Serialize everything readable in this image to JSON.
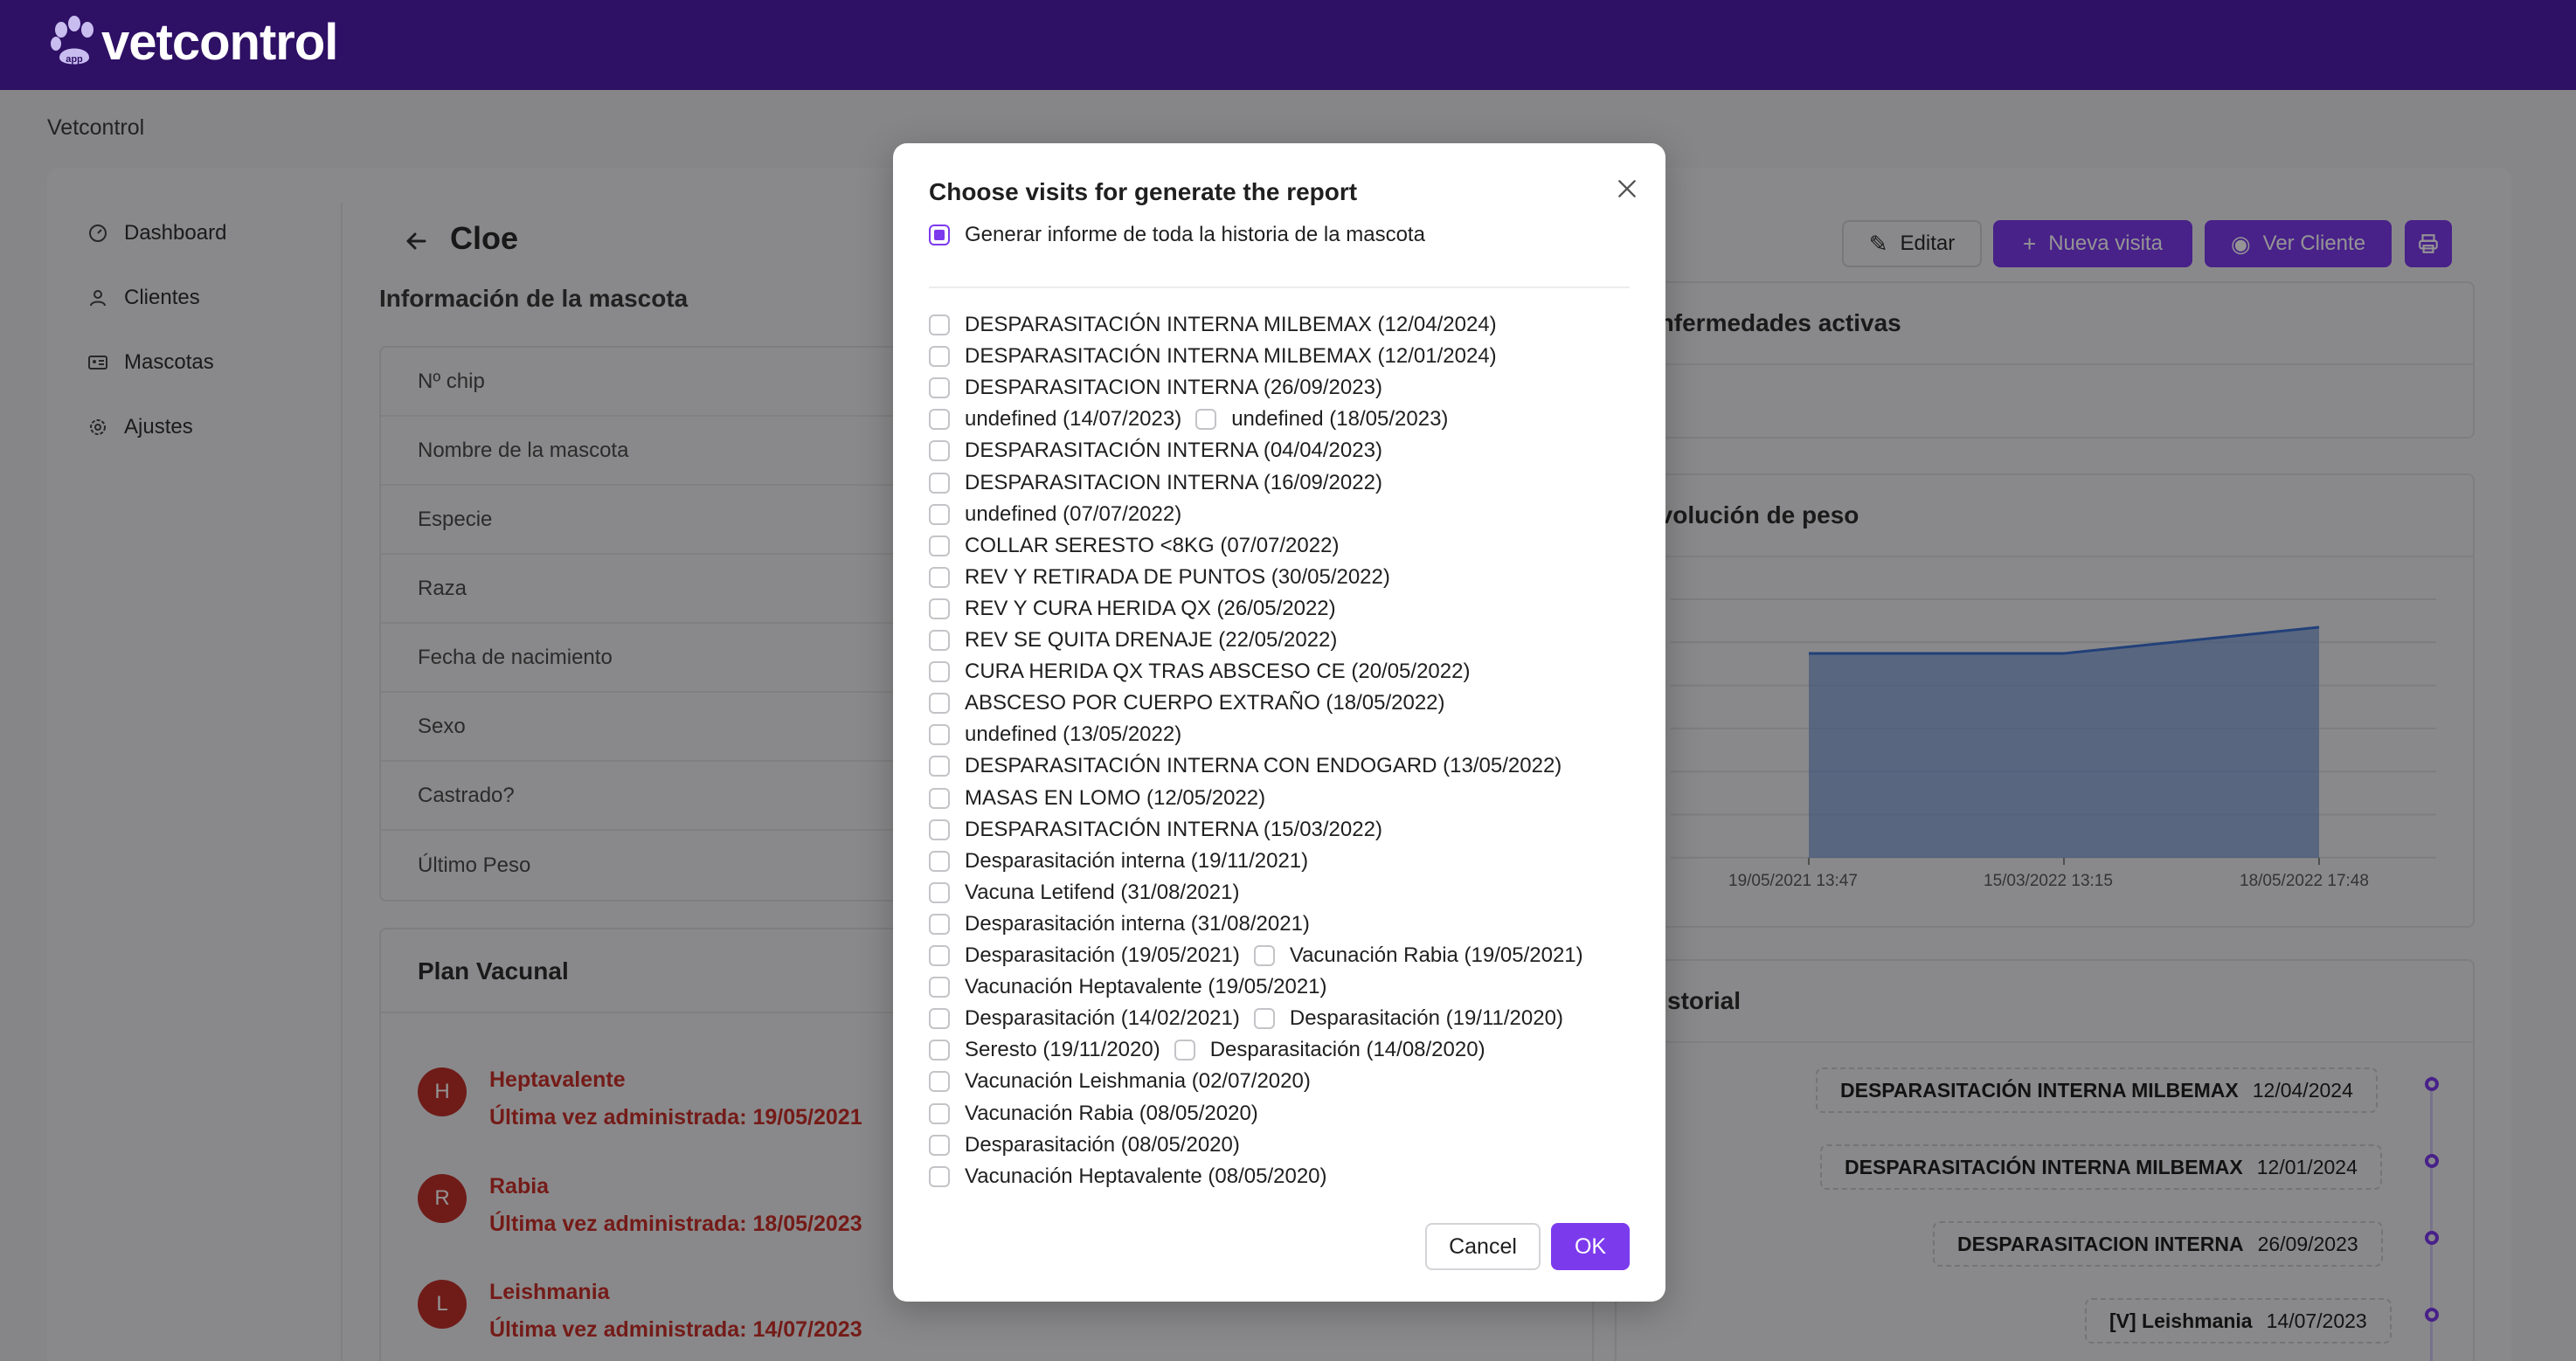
{
  "app": {
    "name": "vetcontrol",
    "badge": "app"
  },
  "breadcrumb": "Vetcontrol",
  "sidebar": {
    "items": [
      {
        "label": "Dashboard",
        "icon": "dashboard-icon"
      },
      {
        "label": "Clientes",
        "icon": "user-icon"
      },
      {
        "label": "Mascotas",
        "icon": "id-card-icon"
      },
      {
        "label": "Ajustes",
        "icon": "gear-icon"
      }
    ]
  },
  "pet": {
    "name": "Cloe",
    "info_title": "Información de la mascota",
    "fields": [
      "Nº chip",
      "Nombre de la mascota",
      "Especie",
      "Raza",
      "Fecha de nacimiento",
      "Sexo",
      "Castrado?",
      "Último Peso"
    ]
  },
  "vaccines": {
    "title": "Plan Vacunal",
    "items": [
      {
        "initial": "H",
        "name": "Heptavalente",
        "last": "Última vez administrada: 19/05/2021"
      },
      {
        "initial": "R",
        "name": "Rabia",
        "last": "Última vez administrada: 18/05/2023"
      },
      {
        "initial": "L",
        "name": "Leishmania",
        "last": "Última vez administrada: 14/07/2023"
      }
    ]
  },
  "toolbar": {
    "edit": "Editar",
    "new_visit": "Nueva visita",
    "view_client": "Ver Cliente"
  },
  "right": {
    "diseases_title": "Enfermedades activas",
    "weight_title": "Evolución de peso",
    "history_title": "Historial",
    "history": [
      {
        "title": "DESPARASITACIÓN INTERNA MILBEMAX",
        "date": "12/04/2024"
      },
      {
        "title": "DESPARASITACIÓN INTERNA MILBEMAX",
        "date": "12/01/2024"
      },
      {
        "title": "DESPARASITACION INTERNA",
        "date": "26/09/2023"
      },
      {
        "title": "[V] Leishmania",
        "date": "14/07/2023"
      }
    ]
  },
  "chart_data": {
    "type": "area",
    "x": [
      "19/05/2021 13:47",
      "15/03/2022 13:15",
      "18/05/2022 17:48"
    ],
    "values": [
      null,
      null,
      null
    ],
    "shape": [
      0.78,
      0.78,
      0.88
    ],
    "grid": true,
    "color": "#7b9bd6"
  },
  "modal": {
    "title": "Choose visits for generate the report",
    "all_history": "Generar informe de toda la historia de la mascota",
    "rows": [
      [
        "DESPARASITACIÓN INTERNA MILBEMAX (12/04/2024)"
      ],
      [
        "DESPARASITACIÓN INTERNA MILBEMAX (12/01/2024)"
      ],
      [
        "DESPARASITACION INTERNA (26/09/2023)"
      ],
      [
        "undefined (14/07/2023)",
        "undefined (18/05/2023)"
      ],
      [
        "DESPARASITACIÓN INTERNA (04/04/2023)"
      ],
      [
        "DESPARASITACION INTERNA (16/09/2022)"
      ],
      [
        "undefined (07/07/2022)"
      ],
      [
        "COLLAR SERESTO <8KG (07/07/2022)"
      ],
      [
        "REV Y RETIRADA DE PUNTOS (30/05/2022)"
      ],
      [
        "REV Y CURA HERIDA QX (26/05/2022)"
      ],
      [
        "REV SE QUITA DRENAJE (22/05/2022)"
      ],
      [
        "CURA HERIDA QX TRAS ABSCESO CE (20/05/2022)"
      ],
      [
        "ABSCESO POR CUERPO EXTRAÑO (18/05/2022)"
      ],
      [
        "undefined (13/05/2022)"
      ],
      [
        "DESPARASITACIÓN INTERNA CON ENDOGARD (13/05/2022)"
      ],
      [
        "MASAS EN LOMO (12/05/2022)"
      ],
      [
        "DESPARASITACIÓN INTERNA (15/03/2022)"
      ],
      [
        "Desparasitación interna (19/11/2021)"
      ],
      [
        "Vacuna Letifend (31/08/2021)"
      ],
      [
        "Desparasitación interna (31/08/2021)"
      ],
      [
        "Desparasitación (19/05/2021)",
        "Vacunación Rabia (19/05/2021)"
      ],
      [
        "Vacunación Heptavalente (19/05/2021)"
      ],
      [
        "Desparasitación (14/02/2021)",
        "Desparasitación (19/11/2020)"
      ],
      [
        "Seresto (19/11/2020)",
        "Desparasitación (14/08/2020)"
      ],
      [
        "Vacunación Leishmania (02/07/2020)"
      ],
      [
        "Vacunación Rabia (08/05/2020)"
      ],
      [
        "Desparasitación (08/05/2020)"
      ],
      [
        "Vacunación Heptavalente (08/05/2020)"
      ]
    ],
    "cancel": "Cancel",
    "ok": "OK"
  },
  "colors": {
    "topbar": "#2e1065",
    "accent": "#7c3aed",
    "danger": "#c9302a"
  }
}
